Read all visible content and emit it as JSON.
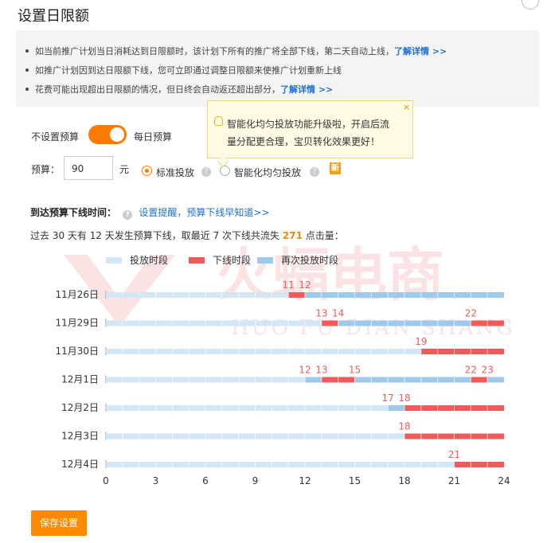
{
  "page": {
    "title": "设置日限额"
  },
  "notice": {
    "line1": "如当前推广计划当日消耗达到日限额时，该计划下所有的推广将全部下线，第二天自动上线，",
    "line1_link": "了解详情 >>",
    "line2": "如推广计划因到达日限额下线，您可立即通过调整日限额来使推广计划重新上线",
    "line3": "花费可能出现超出日限额的情况，但日终会自动返还超出部分，",
    "line3_link": "了解详情 >>"
  },
  "budget_mode": {
    "off_label": "不设置预算",
    "on_label": "每日预算",
    "enabled": true
  },
  "budget": {
    "label": "预算：",
    "value": "90",
    "unit": "元",
    "option_standard": "标准投放",
    "option_smart": "智能化均匀投放",
    "selected": "标准投放",
    "new_badge": "新"
  },
  "tooltip": {
    "line1": "智能化均匀投放功能升级啦，开启后流",
    "line2": "量分配更合理，宝贝转化效果更好！",
    "close": "×"
  },
  "offline": {
    "heading": "到达预算下线时间：",
    "link": "设置提醒，预算下线早知道>>",
    "summary_pre": "过去 30 天有 12 天发生预算下线，取最近 7 次下线共流失 ",
    "summary_num": "271",
    "summary_post": " 点击量："
  },
  "colors": {
    "online": "#d3e6f5",
    "offline": "#f25a5a",
    "reonline": "#9cc9ec",
    "accent": "#ff7a00"
  },
  "watermark": {
    "cn": "火蝠电商",
    "en": "HUO FU DIAN SHANG"
  },
  "chart_data": {
    "type": "gantt",
    "legend": [
      "投放时段",
      "下线时段",
      "再次投放时段"
    ],
    "x_ticks": [
      0,
      3,
      6,
      9,
      12,
      15,
      18,
      21,
      24
    ],
    "xlim": [
      0,
      24
    ],
    "rows": [
      {
        "date": "11月26日",
        "segments": [
          {
            "s": 0,
            "e": 11,
            "t": "online"
          },
          {
            "s": 11,
            "e": 12,
            "t": "offline"
          },
          {
            "s": 12,
            "e": 24,
            "t": "reonline"
          }
        ],
        "labels": [
          11,
          12
        ]
      },
      {
        "date": "11月29日",
        "segments": [
          {
            "s": 0,
            "e": 13,
            "t": "online"
          },
          {
            "s": 13,
            "e": 14,
            "t": "offline"
          },
          {
            "s": 14,
            "e": 22,
            "t": "reonline"
          },
          {
            "s": 22,
            "e": 24,
            "t": "offline"
          }
        ],
        "labels": [
          13,
          14,
          22
        ]
      },
      {
        "date": "11月30日",
        "segments": [
          {
            "s": 0,
            "e": 19,
            "t": "online"
          },
          {
            "s": 19,
            "e": 24,
            "t": "offline"
          }
        ],
        "labels": [
          19
        ]
      },
      {
        "date": "12月1日",
        "segments": [
          {
            "s": 0,
            "e": 12,
            "t": "online"
          },
          {
            "s": 12,
            "e": 13,
            "t": "reonline"
          },
          {
            "s": 13,
            "e": 15,
            "t": "offline"
          },
          {
            "s": 15,
            "e": 22,
            "t": "reonline"
          },
          {
            "s": 22,
            "e": 23,
            "t": "offline"
          },
          {
            "s": 23,
            "e": 24,
            "t": "reonline"
          }
        ],
        "labels": [
          12,
          13,
          15,
          22,
          23
        ]
      },
      {
        "date": "12月2日",
        "segments": [
          {
            "s": 0,
            "e": 17,
            "t": "online"
          },
          {
            "s": 17,
            "e": 18,
            "t": "reonline"
          },
          {
            "s": 18,
            "e": 24,
            "t": "offline"
          }
        ],
        "labels": [
          17,
          18
        ]
      },
      {
        "date": "12月3日",
        "segments": [
          {
            "s": 0,
            "e": 18,
            "t": "online"
          },
          {
            "s": 18,
            "e": 24,
            "t": "offline"
          }
        ],
        "labels": [
          18
        ]
      },
      {
        "date": "12月4日",
        "segments": [
          {
            "s": 0,
            "e": 21,
            "t": "online"
          },
          {
            "s": 21,
            "e": 24,
            "t": "offline"
          }
        ],
        "labels": [
          21
        ]
      }
    ]
  },
  "save_button": "保存设置"
}
